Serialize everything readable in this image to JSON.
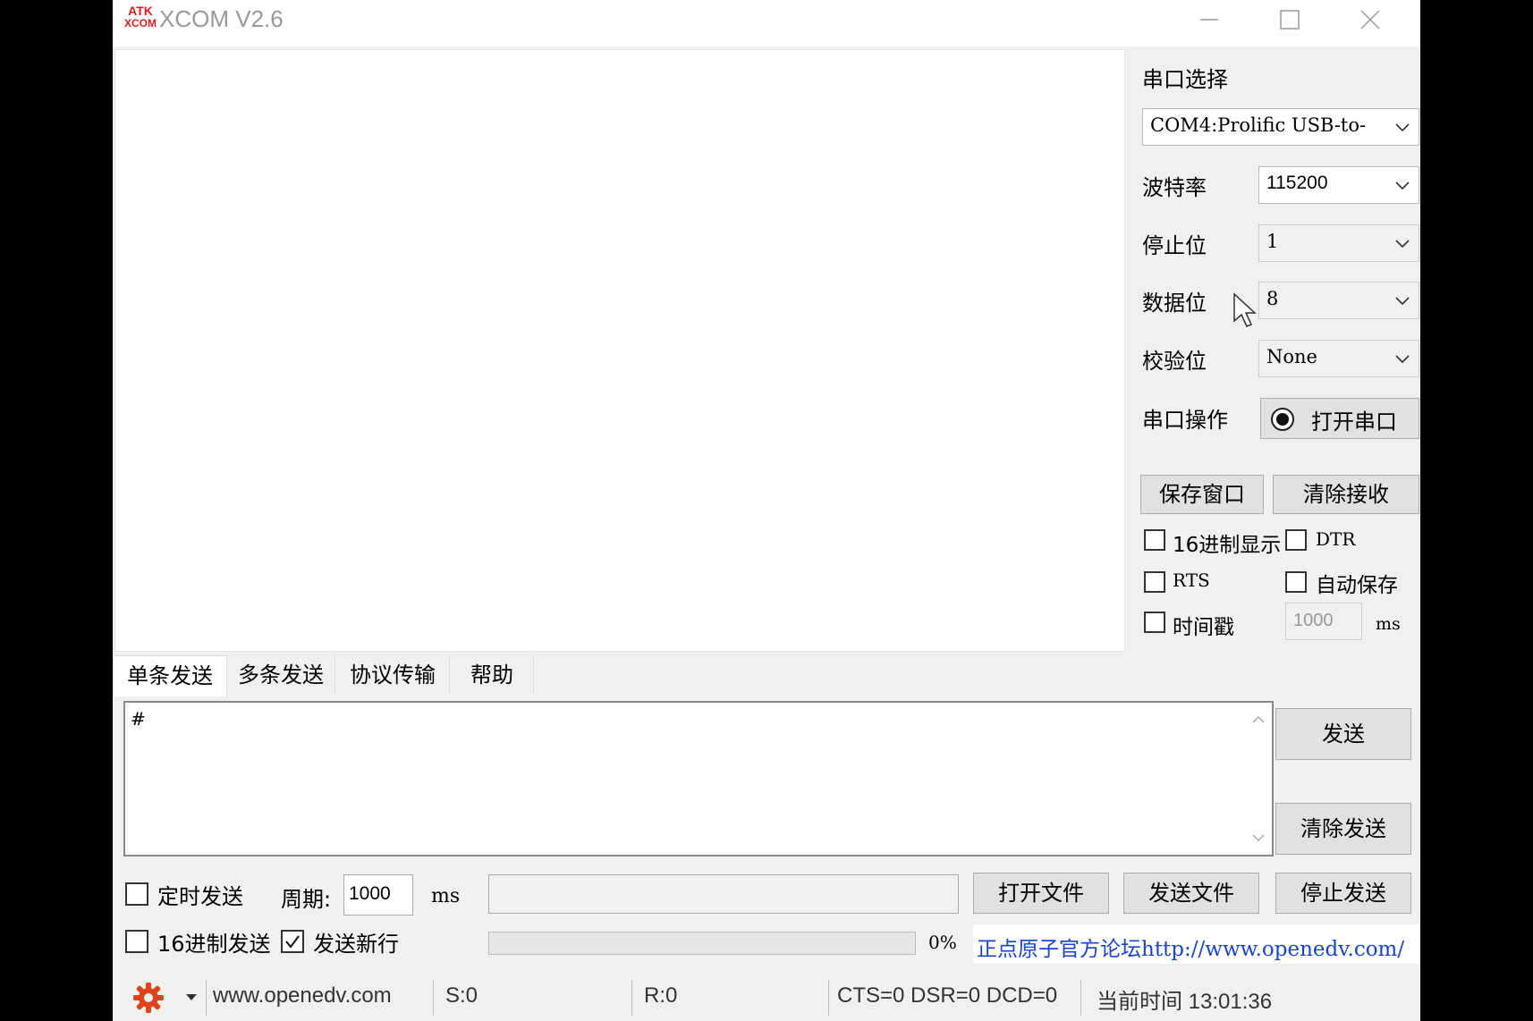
{
  "titlebar": {
    "logo_top": "ATK",
    "logo_bottom": "XCOM",
    "title": "XCOM V2.6"
  },
  "side": {
    "port_select_label": "串口选择",
    "port_value": "COM4:Prolific USB-to-",
    "baud_label": "波特率",
    "baud_value": "115200",
    "stop_label": "停止位",
    "stop_value": "1",
    "data_label": "数据位",
    "data_value": "8",
    "parity_label": "校验位",
    "parity_value": "None",
    "op_label": "串口操作",
    "open_btn": "打开串口",
    "save_window": "保存窗口",
    "clear_recv": "清除接收",
    "hex_display": "16进制显示",
    "dtr": "DTR",
    "rts": "RTS",
    "auto_save": "自动保存",
    "timestamp": "时间戳",
    "timestamp_value": "1000",
    "timestamp_unit": "ms"
  },
  "tabs": [
    "单条发送",
    "多条发送",
    "协议传输",
    "帮助"
  ],
  "send": {
    "text": "#",
    "send_btn": "发送",
    "clear_send_btn": "清除发送",
    "timed_send": "定时发送",
    "period_label": "周期:",
    "period_value": "1000",
    "period_unit": "ms",
    "open_file": "打开文件",
    "send_file": "发送文件",
    "stop_send": "停止发送",
    "hex_send": "16进制发送",
    "send_newline": "发送新行",
    "newline_checked": true,
    "progress": "0%",
    "forum_link": "正点原子官方论坛http://www.openedv.com/"
  },
  "status": {
    "url": "www.openedv.com",
    "sent": "S:0",
    "recv": "R:0",
    "lines": "CTS=0 DSR=0 DCD=0",
    "time": "当前时间 13:01:36"
  },
  "colors": {
    "logo": "#d62020",
    "link": "#1a44c8",
    "gear": "#e0421a"
  }
}
